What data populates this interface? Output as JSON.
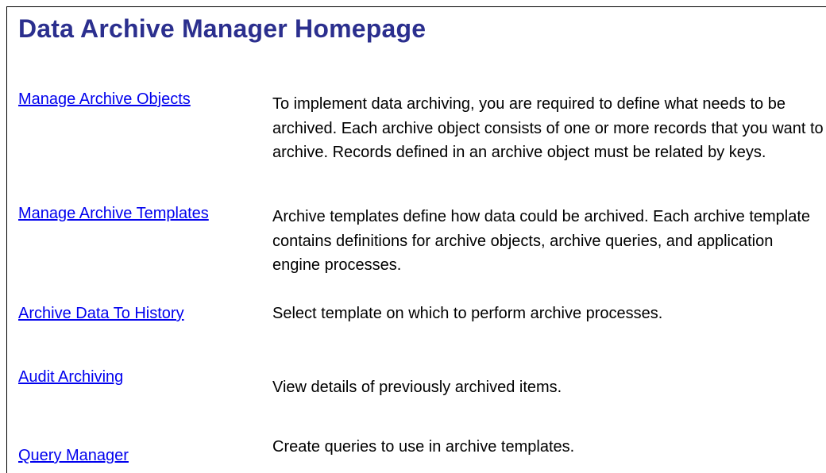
{
  "page": {
    "title": "Data Archive Manager Homepage"
  },
  "items": [
    {
      "link": "Manage Archive Objects",
      "description": "To implement data archiving, you are required to define what needs to be archived. Each archive object consists of one or more records that you want to archive. Records defined in an archive object must be related by keys."
    },
    {
      "link": "Manage Archive Templates",
      "description": "Archive templates define how data could be archived. Each archive template contains definitions for archive objects, archive queries, and application engine processes."
    },
    {
      "link": "Archive Data To History",
      "description": "Select template on which to perform archive processes."
    },
    {
      "link": "Audit Archiving",
      "description": "View details of previously archived items."
    },
    {
      "link": "Query Manager",
      "description": "Create queries to use in archive templates."
    }
  ],
  "colors": {
    "title": "#2b2f8e",
    "link": "#0000ee",
    "text": "#000000",
    "border": "#000000"
  }
}
